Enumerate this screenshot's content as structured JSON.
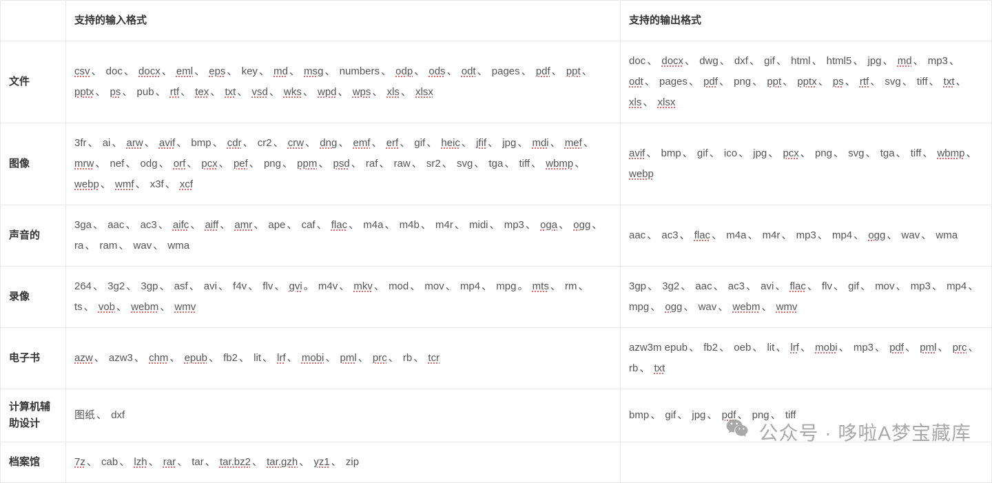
{
  "headers": {
    "input": "支持的输入格式",
    "output": "支持的输出格式"
  },
  "sep": "、",
  "underlined": [
    "csv",
    "docx",
    "eml",
    "eps",
    "md",
    "msg",
    "odp",
    "ods",
    "odt",
    "pdf",
    "ppt",
    "pptx",
    "ps",
    "rtf",
    "tex",
    "txt",
    "vsd",
    "wks",
    "wpd",
    "wps",
    "xls",
    "xlsx",
    "arw",
    "avif",
    "cdr",
    "crw",
    "dng",
    "emf",
    "erf",
    "heic",
    "jfif",
    "mdi",
    "mef",
    "mrw",
    "orf",
    "pcx",
    "pef",
    "ppm",
    "psd",
    "wbmp",
    "webp",
    "wmf",
    "xcf",
    "aifc",
    "aiff",
    "amr",
    "flac",
    "oga",
    "ogg",
    "gvi",
    "mkv",
    "mts",
    "vob",
    "webm",
    "wmv",
    "azw",
    "chm",
    "epub",
    "lrf",
    "mobi",
    "pml",
    "prc",
    "tcr",
    "7z",
    "lzh",
    "rar",
    "tar.bz2",
    "tar.gzh",
    "yz1"
  ],
  "rows": [
    {
      "category": "文件",
      "input": [
        "csv",
        "doc",
        "docx",
        "eml",
        "eps",
        "key",
        "md",
        "msg",
        "numbers",
        "odp",
        "ods",
        "odt",
        "pages",
        "pdf",
        "ppt",
        "pptx",
        "ps",
        "pub",
        "rtf",
        "tex",
        "txt",
        "vsd",
        "wks",
        "wpd",
        "wps",
        "xls",
        "xlsx"
      ],
      "output": [
        "doc",
        "docx",
        "dwg",
        "dxf",
        "gif",
        "html",
        "html5",
        "jpg",
        "md",
        "mp3",
        "odt",
        "pages",
        "pdf",
        "png",
        "ppt",
        "pptx",
        "ps",
        "rtf",
        "svg",
        "tiff",
        "txt",
        "xls",
        "xlsx"
      ]
    },
    {
      "category": "图像",
      "input": [
        "3fr",
        "ai",
        "arw",
        "avif",
        "bmp",
        "cdr",
        "cr2",
        "crw",
        "dng",
        "emf",
        "erf",
        "gif",
        "heic",
        "jfif",
        "jpg",
        "mdi",
        "mef",
        "mrw",
        "nef",
        "odg",
        "orf",
        "pcx",
        "pef",
        "png",
        "ppm",
        "psd",
        "raf",
        "raw",
        "sr2",
        "svg",
        "tga",
        "tiff",
        "wbmp",
        "webp",
        "wmf",
        "x3f",
        "xcf"
      ],
      "output": [
        "avif",
        "bmp",
        "gif",
        "ico",
        "jpg",
        "pcx",
        "png",
        "svg",
        "tga",
        "tiff",
        "wbmp",
        "webp"
      ]
    },
    {
      "category": "声音的",
      "input": [
        "3ga",
        "aac",
        "ac3",
        "aifc",
        "aiff",
        "amr",
        "ape",
        "caf",
        "flac",
        "m4a",
        "m4b",
        "m4r",
        "midi",
        "mp3",
        "oga",
        "ogg",
        "ra",
        "ram",
        "wav",
        "wma"
      ],
      "output": [
        "aac",
        "ac3",
        "flac",
        "m4a",
        "m4r",
        "mp3",
        "mp4",
        "ogg",
        "wav",
        "wma"
      ]
    },
    {
      "category": "录像",
      "input_special": [
        {
          "items": [
            "264",
            "3g2",
            "3gp",
            "asf",
            "avi",
            "f4v",
            "flv",
            "gvi"
          ],
          "end": "。"
        },
        {
          "items": [
            "m4v",
            "mkv",
            "mod",
            "mov",
            "mp4",
            "mpg"
          ],
          "end": "。"
        },
        {
          "items": [
            "mts",
            "rm",
            "ts",
            "vob",
            "webm",
            "wmv"
          ],
          "end": ""
        }
      ],
      "output": [
        "3gp",
        "3g2",
        "aac",
        "ac3",
        "avi",
        "flac",
        "flv",
        "gif",
        "mov",
        "mp3",
        "mp4",
        "mpg",
        "ogg",
        "wav",
        "webm",
        "wmv"
      ]
    },
    {
      "category": "电子书",
      "input": [
        "azw",
        "azw3",
        "chm",
        "epub",
        "fb2",
        "lit",
        "lrf",
        "mobi",
        "pml",
        "prc",
        "rb",
        "tcr"
      ],
      "output": [
        "azw3m epub",
        "fb2",
        "oeb",
        "lit",
        "lrf",
        "mobi",
        "mp3",
        "pdf",
        "pml",
        "prc",
        "rb",
        "txt"
      ]
    },
    {
      "category": "计算机辅助设计",
      "input": [
        "图纸",
        "dxf"
      ],
      "output": [
        "bmp",
        "gif",
        "jpg",
        "pdf",
        "png",
        "tiff"
      ]
    },
    {
      "category": "档案馆",
      "input": [
        "7z",
        "cab",
        "lzh",
        "rar",
        "tar",
        "tar.bz2",
        "tar.gzh",
        "yz1",
        "zip"
      ],
      "output": []
    }
  ],
  "watermark": "公众号 · 哆啦A梦宝藏库"
}
